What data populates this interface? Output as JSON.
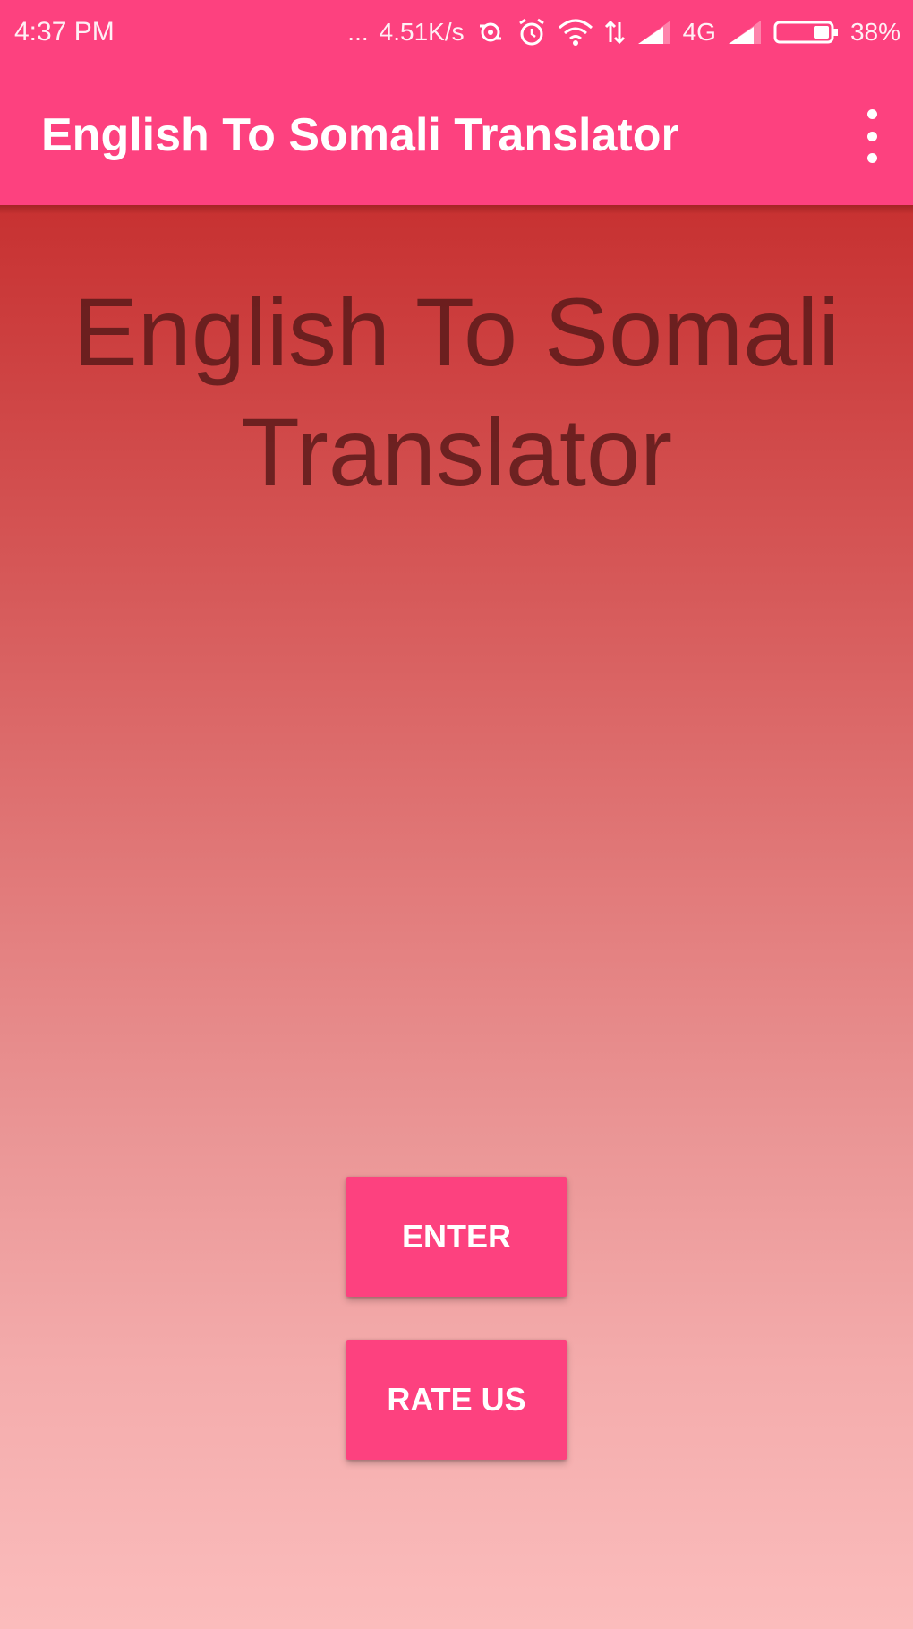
{
  "status_bar": {
    "time": "4:37 PM",
    "more_indicator": "...",
    "network_speed": "4.51K/s",
    "network_type": "4G",
    "battery_percent": "38%",
    "icons": [
      "notification-dots-icon",
      "sync-icon",
      "alarm-icon",
      "wifi-icon",
      "data-arrows-icon",
      "signal-icon",
      "signal-icon",
      "battery-icon"
    ]
  },
  "app_bar": {
    "title": "English To Somali Translator",
    "menu_icon": "more-vert-icon"
  },
  "main": {
    "title": "English To Somali Translator",
    "enter_label": "ENTER",
    "rate_label": "RATE US"
  },
  "colors": {
    "accent": "#fd417f",
    "gradient_top": "#c73131",
    "gradient_bottom": "#fbbcbc",
    "hero_text": "#5c1a1a"
  }
}
